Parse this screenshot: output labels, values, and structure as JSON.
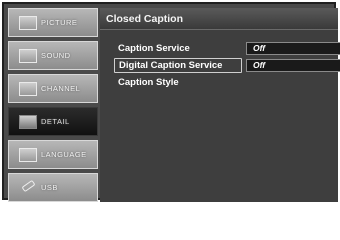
{
  "sidebar": {
    "items": [
      {
        "label": "PICTURE",
        "icon": "picture-icon",
        "active": false
      },
      {
        "label": "SOUND",
        "icon": "sound-icon",
        "active": false
      },
      {
        "label": "CHANNEL",
        "icon": "channel-icon",
        "active": false
      },
      {
        "label": "DETAIL",
        "icon": "detail-icon",
        "active": true
      },
      {
        "label": "LANGUAGE",
        "icon": "language-icon",
        "active": false
      },
      {
        "label": "USB",
        "icon": "usb-icon",
        "active": false
      }
    ]
  },
  "panel": {
    "title": "Closed Caption",
    "rows": [
      {
        "label": "Caption Service",
        "value": "Off",
        "selected": false
      },
      {
        "label": "Digital Caption Service",
        "value": "Off",
        "selected": true
      },
      {
        "label": "Caption Style",
        "value": "",
        "selected": false
      }
    ]
  }
}
